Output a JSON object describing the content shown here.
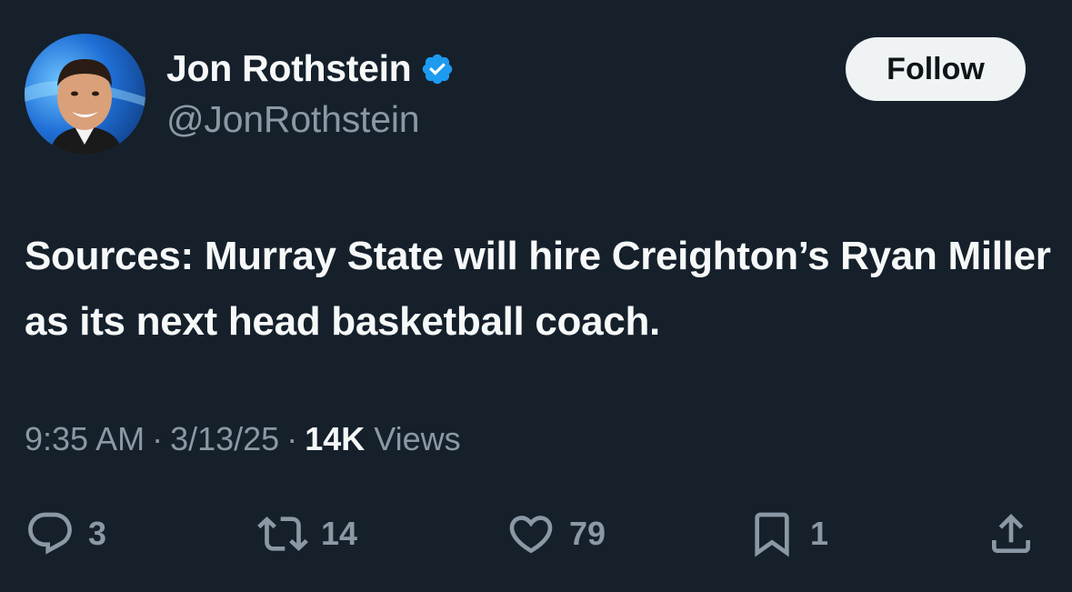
{
  "author": {
    "display_name": "Jon Rothstein",
    "handle": "@JonRothstein",
    "verified_icon": "verified-badge-icon",
    "badge_color": "#1d9bf0"
  },
  "follow_label": "Follow",
  "tweet": {
    "text": "Sources: Murray State will hire Creighton’s Ryan Miller as its next head basketball coach."
  },
  "meta": {
    "time": "9:35 AM",
    "separator": "·",
    "date": "3/13/25",
    "views_count": "14K",
    "views_label": "Views"
  },
  "actions": {
    "replies": "3",
    "reposts": "14",
    "likes": "79",
    "bookmarks": "1"
  },
  "colors": {
    "background": "#15202b",
    "primary_text": "#f7f9f9",
    "secondary_text": "#8b98a5",
    "button_bg": "#eff3f4"
  }
}
